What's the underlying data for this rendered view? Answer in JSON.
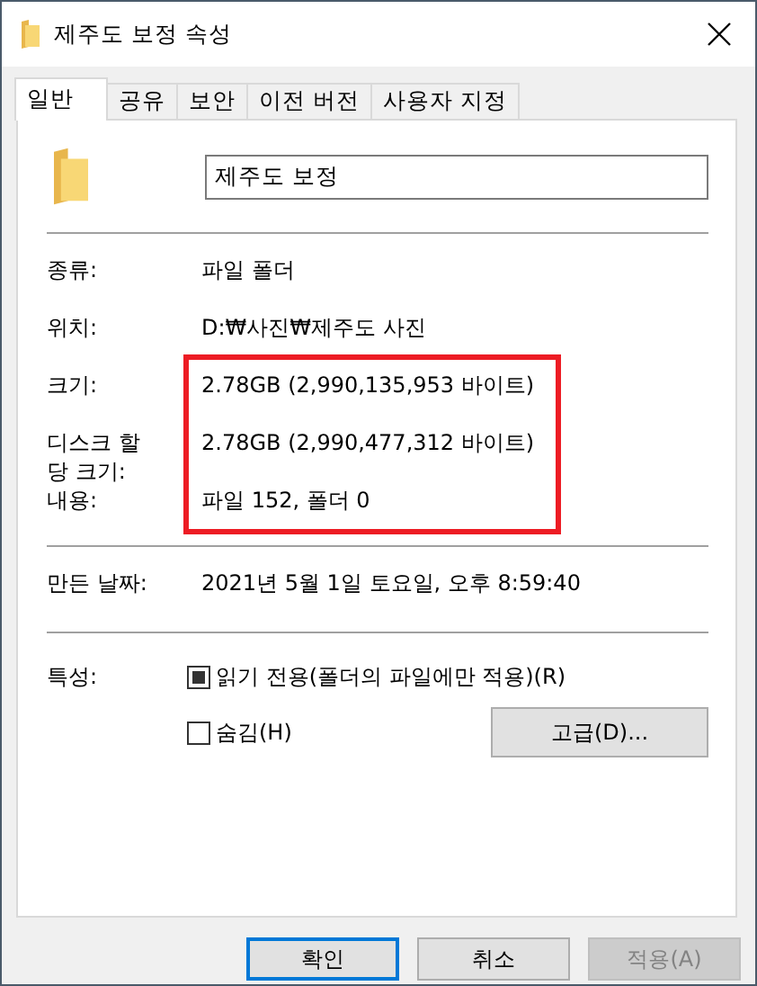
{
  "window": {
    "title": "제주도 보정 속성"
  },
  "tabs": [
    {
      "label": "일반",
      "selected": true
    },
    {
      "label": "공유",
      "selected": false
    },
    {
      "label": "보안",
      "selected": false
    },
    {
      "label": "이전 버전",
      "selected": false
    },
    {
      "label": "사용자 지정",
      "selected": false
    }
  ],
  "name_field": {
    "value": "제주도 보정"
  },
  "info_rows": [
    {
      "label": "종류:",
      "value": "파일 폴더"
    },
    {
      "label": "위치:",
      "value": "D:₩사진₩제주도 사진"
    }
  ],
  "highlighted_rows": [
    {
      "label": "크기:",
      "value": "2.78GB (2,990,135,953 바이트)"
    },
    {
      "label": "디스크 할당 크기:",
      "value": "2.78GB (2,990,477,312 바이트)"
    },
    {
      "label": "내용:",
      "value": "파일 152, 폴더 0"
    }
  ],
  "date_rows": [
    {
      "label": "만든 날짜:",
      "value": "2021년 5월 1일 토요일, 오후 8:59:40"
    }
  ],
  "attributes": {
    "label": "특성:",
    "options": [
      {
        "label": "읽기 전용(폴더의 파일에만 적용)(R)",
        "indeterminate": true
      },
      {
        "label": "숨김(H)",
        "checked": false
      }
    ],
    "advanced_button": "고급(D)..."
  },
  "buttons": [
    {
      "label": "확인",
      "default": true,
      "disabled": false
    },
    {
      "label": "취소",
      "default": false,
      "disabled": false
    },
    {
      "label": "적용(A)",
      "default": false,
      "disabled": true
    }
  ]
}
